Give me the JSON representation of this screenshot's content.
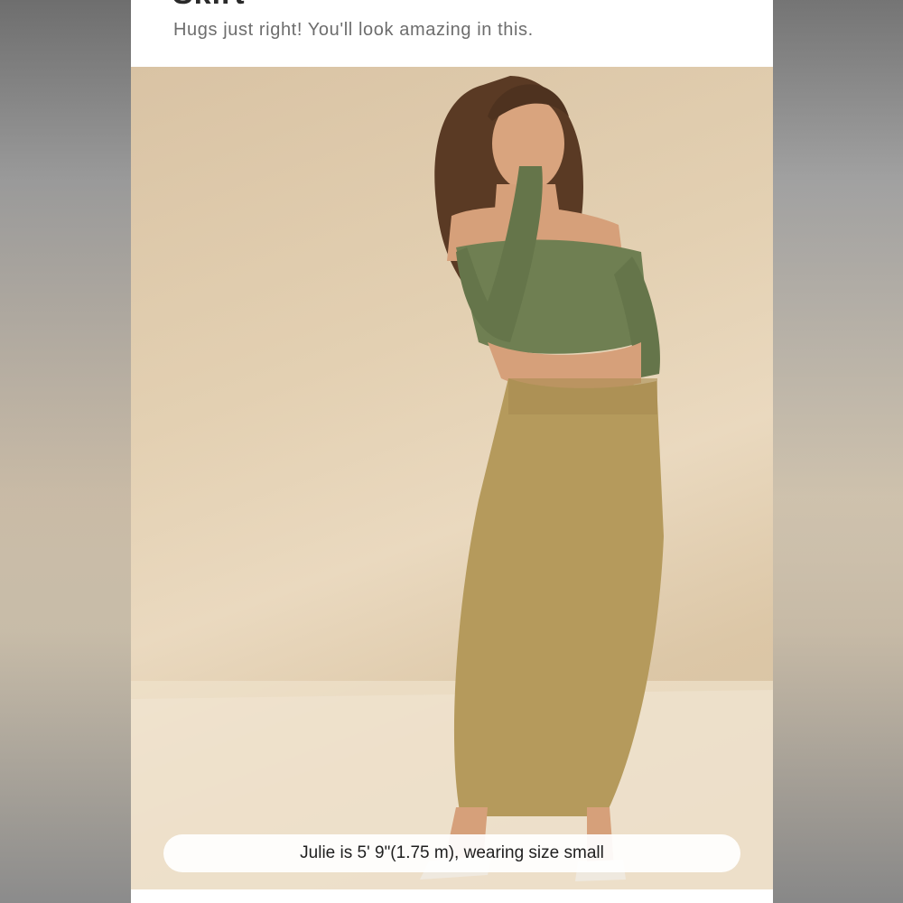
{
  "header": {
    "title_fragment": "Skirt",
    "subtitle": "Hugs just right! You'll look amazing in this."
  },
  "photo": {
    "alt": "",
    "caption": "Julie is 5' 9\"(1.75 m), wearing size small"
  },
  "colors": {
    "backdrop_wall": "#e3d0b2",
    "top_green": "#6f7f52",
    "skirt_khaki": "#b59a5c",
    "hair_brown": "#5a3a24",
    "skin": "#d9a47e"
  }
}
